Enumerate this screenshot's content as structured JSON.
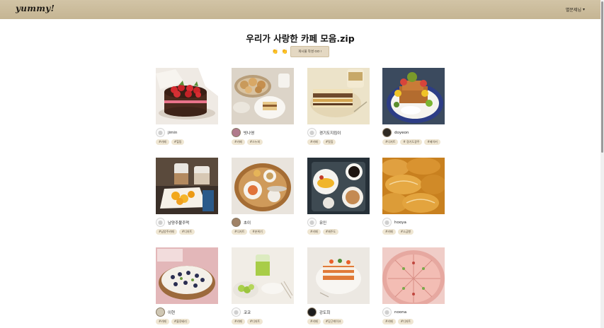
{
  "header": {
    "logo": "yummy!",
    "user_menu": "별문제님",
    "chevron_icon": "chevron-down-icon"
  },
  "main": {
    "title": "우리가 사랑한 카페 모음.zip",
    "hands_icon": "clapping-hands-icon",
    "write_button": "게시물 작성 GO !"
  },
  "cards": [
    {
      "author": "jimin",
      "avatar": "default",
      "tags": [
        "#카페",
        "#힐링"
      ]
    },
    {
      "author": "빗나영",
      "avatar": "photo",
      "tags": [
        "#카페",
        "#스누피"
      ]
    },
    {
      "author": "경기도지킴이",
      "avatar": "default",
      "tags": [
        "#카페",
        "#맛집"
      ]
    },
    {
      "author": "doyeon",
      "avatar": "photo",
      "tags": [
        "#디저트",
        "# 경기도광주",
        "#베이커"
      ]
    },
    {
      "author": "남양주불주먹",
      "avatar": "default",
      "tags": [
        "#남양주카페",
        "#디저트"
      ]
    },
    {
      "author": "초이",
      "avatar": "photo",
      "tags": [
        "#디저트",
        "#분위기"
      ]
    },
    {
      "author": "유인",
      "avatar": "default",
      "tags": [
        "#카페",
        "#제주도"
      ]
    },
    {
      "author": "hooya",
      "avatar": "default",
      "tags": [
        "#카페",
        "#소금빵"
      ]
    },
    {
      "author": "이현",
      "avatar": "photo",
      "tags": [
        "#카페",
        "#블루베리"
      ]
    },
    {
      "author": "코코",
      "avatar": "default",
      "tags": [
        "#카페",
        "#디저트"
      ]
    },
    {
      "author": "강도희",
      "avatar": "photo",
      "tags": [
        "#카페",
        "#당근케이크"
      ]
    },
    {
      "author": "noona",
      "avatar": "default",
      "tags": [
        "#카페",
        "#디저트"
      ]
    }
  ]
}
